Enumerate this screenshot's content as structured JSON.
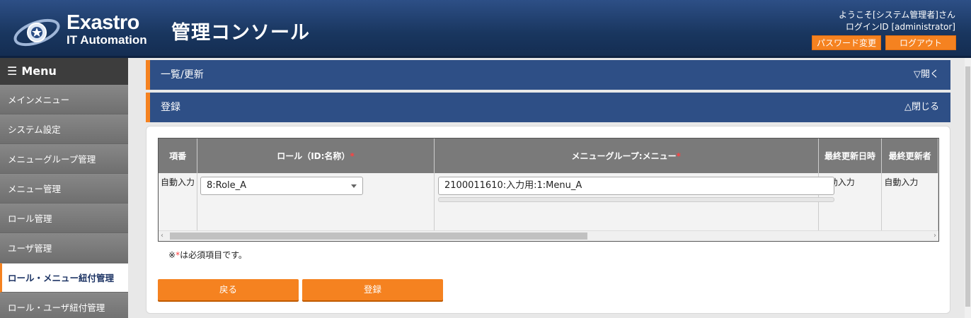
{
  "header": {
    "logo_main": "Exastro",
    "logo_sub": "IT Automation",
    "title": "管理コンソール",
    "welcome": "ようこそ[システム管理者]さん",
    "login_id": "ログインID [administrator]",
    "password_button": "パスワード変更",
    "logout_button": "ログアウト"
  },
  "sidebar": {
    "title": "Menu",
    "items": [
      {
        "label": "メインメニュー"
      },
      {
        "label": "システム設定"
      },
      {
        "label": "メニューグループ管理"
      },
      {
        "label": "メニュー管理"
      },
      {
        "label": "ロール管理"
      },
      {
        "label": "ユーザ管理"
      },
      {
        "label": "ロール・メニュー紐付管理"
      },
      {
        "label": "ロール・ユーザ紐付管理"
      }
    ],
    "active_index": 6
  },
  "panels": {
    "list": {
      "title": "一覧/更新",
      "toggle": "▽開く"
    },
    "register": {
      "title": "登録",
      "toggle": "△閉じる"
    }
  },
  "form_table": {
    "headers": [
      "項番",
      "ロール（ID:名称）",
      "メニューグループ:メニュー",
      "最終更新日時",
      "最終更新者"
    ],
    "required_mark": "*",
    "row": {
      "item_no": "自動入力",
      "role_select": "8:Role_A",
      "menu_value": "2100011610:入力用:1:Menu_A",
      "last_updated": "自動入力",
      "last_updater": "自動入力"
    }
  },
  "note": {
    "prefix": "※",
    "mark": "*",
    "text": "は必須項目です。"
  },
  "buttons": {
    "back": "戻る",
    "register": "登録"
  },
  "colors": {
    "header_bg": "#1e3d6e",
    "accent_orange": "#f58220",
    "panel_bar": "#2e4f86",
    "required": "#ff4040"
  }
}
